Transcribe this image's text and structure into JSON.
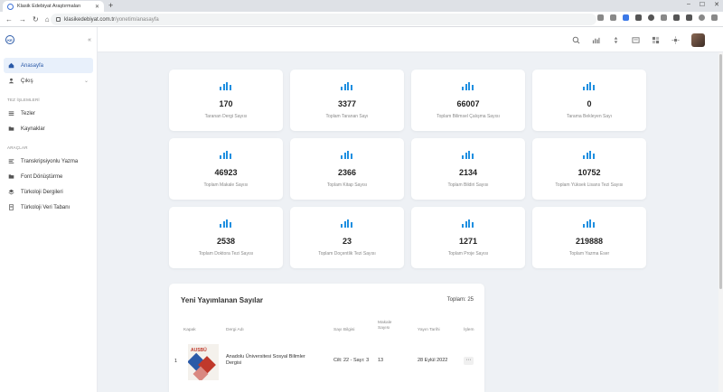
{
  "browser": {
    "tab_title": "Klasik Edebiyat Araştırmaları",
    "url_domain": "klasikedebiyat.com.tr",
    "url_path": "/yonetim/anasayfa"
  },
  "sidebar": {
    "items": [
      {
        "label": "Anasayfa",
        "icon": "home-icon"
      },
      {
        "label": "Çıkış",
        "icon": "user-icon"
      }
    ],
    "section_tez": "TEZ İŞLEMLERİ",
    "tez_items": [
      {
        "label": "Tezler",
        "icon": "list-icon"
      },
      {
        "label": "Kaynaklar",
        "icon": "folder-icon"
      }
    ],
    "section_araclar": "ARAÇLAR",
    "arac_items": [
      {
        "label": "Transkripsiyonlu Yazma",
        "icon": "text-icon"
      },
      {
        "label": "Font Dönüştürme",
        "icon": "folder-icon"
      },
      {
        "label": "Türkoloji Dergileri",
        "icon": "layers-icon"
      },
      {
        "label": "Türkoloji Veri Tabanı",
        "icon": "document-icon"
      }
    ]
  },
  "stats": [
    {
      "value": "170",
      "label": "Taranan Dergi Sayısı"
    },
    {
      "value": "3377",
      "label": "Toplam Taranan Sayı"
    },
    {
      "value": "66007",
      "label": "Toplam Bilimsel Çalışma Sayısı"
    },
    {
      "value": "0",
      "label": "Tarama Bekleyen Sayı"
    },
    {
      "value": "46923",
      "label": "Toplam Makale Sayısı"
    },
    {
      "value": "2366",
      "label": "Toplam Kitap Sayısı"
    },
    {
      "value": "2134",
      "label": "Toplam Bildiri Sayısı"
    },
    {
      "value": "10752",
      "label": "Toplam Yüksek Lisans Tezi Sayısı"
    },
    {
      "value": "2538",
      "label": "Toplam Doktora Tezi Sayısı"
    },
    {
      "value": "23",
      "label": "Toplam Doçentlik Tezi Sayısı"
    },
    {
      "value": "1271",
      "label": "Toplam Proje Sayısı"
    },
    {
      "value": "219888",
      "label": "Toplam Yazma Eser"
    }
  ],
  "panel": {
    "title": "Yeni Yayımlanan Sayılar",
    "total": "Toplam: 25",
    "headers": {
      "cover": "Kapak",
      "journal": "Dergi Adı",
      "issue": "Sayı Bilgisi",
      "article_count": "Makale\nSayısı",
      "date": "Yayın Tarihi",
      "action": "İşlem"
    },
    "rows": [
      {
        "index": "1",
        "cover_brand": "AUSBÜ",
        "journal": "Anadolu Üniversitesi Sosyal Bilimler Dergisi",
        "issue": "Cilt: 22 - Sayı: 3",
        "article_count": "13",
        "date": "28 Eylül 2022",
        "action": "⋯"
      }
    ]
  },
  "colors": {
    "accent": "#1f8fe0",
    "active_bg": "#e8f0fb",
    "brand": "#2b5aa8"
  }
}
